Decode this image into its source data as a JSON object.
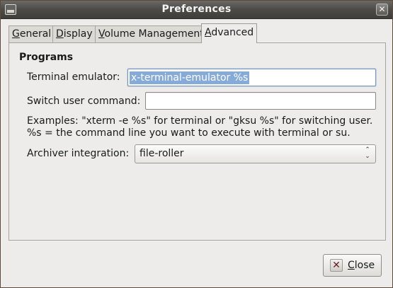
{
  "window": {
    "title": "Preferences",
    "close_glyph": "✕",
    "app_icon": "window-icon"
  },
  "tabs": [
    {
      "label_mnemonic": "G",
      "label_rest": "eneral",
      "active": false
    },
    {
      "label_mnemonic": "D",
      "label_rest": "isplay",
      "active": false
    },
    {
      "label_mnemonic": "V",
      "label_rest": "olume Management",
      "active": false
    },
    {
      "label_mnemonic": "A",
      "label_rest": "dvanced",
      "active": true
    }
  ],
  "programs": {
    "section_title": "Programs",
    "terminal_label": "Terminal emulator:",
    "terminal_value": "x-terminal-emulator %s",
    "switch_user_label": "Switch user command:",
    "switch_user_value": "",
    "examples_line1": "Examples: \"xterm -e %s\" for terminal or \"gksu %s\" for switching user.",
    "examples_line2": "%s = the command line you want to execute with terminal or su.",
    "archiver_label": "Archiver integration:",
    "archiver_value": "file-roller",
    "archiver_arrow_up": "⌃",
    "archiver_arrow_down": "⌄"
  },
  "footer": {
    "close_mnemonic": "C",
    "close_rest": "lose",
    "close_icon_glyph": "✕"
  },
  "colors": {
    "titlebar": "#4e4d49",
    "selection": "#86abd9",
    "window_bg": "#edecea"
  }
}
